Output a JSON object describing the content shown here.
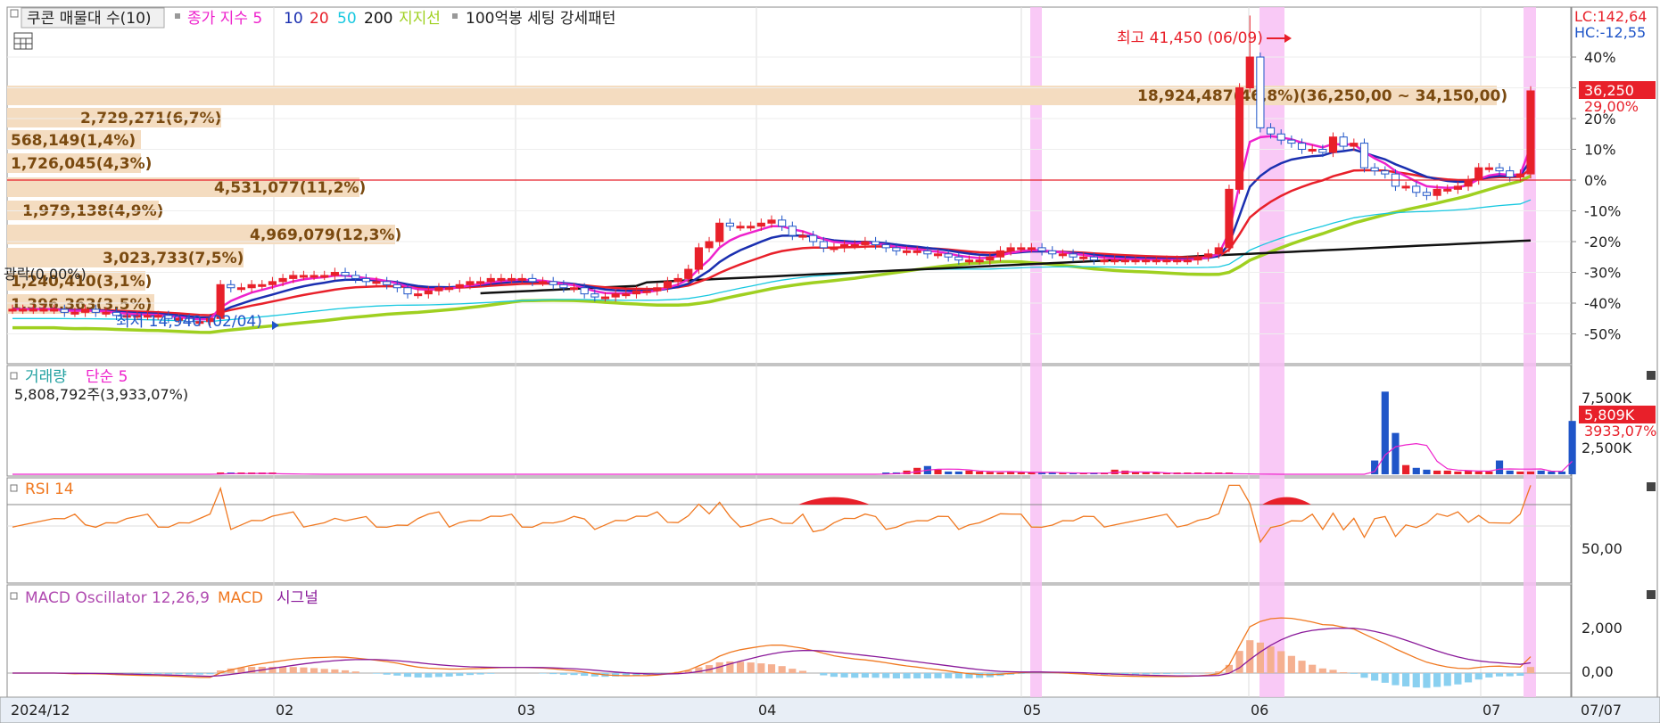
{
  "header": {
    "title_button": "쿠콘 매물대 수(10)",
    "ma_label": "종가 지수 5",
    "ma_periods": [
      {
        "label": "10",
        "color": "#1a2fb0"
      },
      {
        "label": "20",
        "color": "#e8202a"
      },
      {
        "label": "50",
        "color": "#18c8e0"
      },
      {
        "label": "200",
        "color": "#111111"
      },
      {
        "label": "지지선",
        "color": "#9fd020"
      }
    ],
    "extra_label": "100억봉 세팅 강세패턴"
  },
  "colors": {
    "up": "#e8202a",
    "down": "#1f55c8",
    "ma5": "#ee22cc",
    "ma10": "#1a2fb0",
    "ma20": "#e8202a",
    "ma50": "#18c8e0",
    "ma200": "#111111",
    "support": "#9fd020",
    "rsi": "#f07820",
    "signal": "#8a1a9a",
    "osc_pos": "#f5b090",
    "osc_neg": "#8ad0f0",
    "highlight": "#f8c0f4",
    "profile": "#f4dcc0",
    "profile_text": "#7a4a10"
  },
  "price_panel": {
    "lc": "LC:142,64",
    "hc": "HC:-12,55",
    "y_ticks": [
      "40%",
      "30%",
      "20%",
      "10%",
      "0%",
      "-10%",
      "-20%",
      "-30%",
      "-40%",
      "-50%"
    ],
    "current_price": "36,250",
    "current_pct": "29,00%",
    "high_label": "최고 41,450 (06/09)",
    "low_label": "최저 14,940 (02/04)",
    "decline_label": "광락(0,00%)",
    "volume_profile": [
      {
        "text": "18,924,487(46,8%)(36,250,00 ~ 34,150,00)"
      },
      {
        "text": "2,729,271(6,7%)"
      },
      {
        "text": "568,149(1,4%)"
      },
      {
        "text": "1,726,045(4,3%)"
      },
      {
        "text": "4,531,077(11,2%)"
      },
      {
        "text": "1,979,138(4,9%)"
      },
      {
        "text": "4,969,079(12,3%)"
      },
      {
        "text": "3,023,733(7,5%)"
      },
      {
        "text": "1,240,410(3,1%)"
      },
      {
        "text": "1,396,363(3,5%)"
      }
    ]
  },
  "volume_panel": {
    "title": "거래량",
    "ma_label": "단순 5",
    "summary": "5,808,792주(3,933,07%)",
    "y_ticks": [
      "7,500K",
      "2,500K"
    ],
    "current": "5,809K",
    "current_pct": "3933,07%"
  },
  "rsi_panel": {
    "title": "RSI 14",
    "y_tick": "50,00"
  },
  "macd_panel": {
    "title": "MACD Oscillator 12,26,9",
    "macd_label": "MACD",
    "signal_label": "시그널",
    "y_ticks": [
      "2,000",
      "0,00"
    ]
  },
  "x_axis": {
    "labels": [
      "2024/12",
      "02",
      "03",
      "04",
      "05",
      "06",
      "07"
    ],
    "end_label": "07/07"
  },
  "chart_data": {
    "type": "candlestick",
    "x_labels": [
      "2024/12",
      "02",
      "03",
      "04",
      "05",
      "06",
      "07"
    ],
    "y_unit": "percent",
    "price_high": {
      "value": 41450,
      "date": "06/09"
    },
    "price_low": {
      "value": 14940,
      "date": "02/04"
    },
    "last_price": 36250,
    "last_change_pct": 29.0,
    "close_pct": [
      -42,
      -42,
      -42,
      -42,
      -42,
      -43,
      -43,
      -42,
      -43,
      -43,
      -44,
      -44,
      -44,
      -44,
      -44,
      -45,
      -45,
      -46,
      -46,
      -45,
      -34,
      -35,
      -35,
      -34,
      -34,
      -33,
      -32,
      -31,
      -31,
      -31,
      -31,
      -30,
      -31,
      -32,
      -33,
      -33,
      -34,
      -35,
      -37,
      -37,
      -36,
      -35,
      -35,
      -34,
      -33,
      -33,
      -32,
      -32,
      -32,
      -32,
      -33,
      -33,
      -34,
      -35,
      -35,
      -37,
      -38,
      -38,
      -37,
      -37,
      -36,
      -36,
      -35,
      -33,
      -32,
      -29,
      -22,
      -20,
      -14,
      -15,
      -15,
      -15,
      -14,
      -13,
      -15,
      -18,
      -18,
      -20,
      -22,
      -22,
      -21,
      -21,
      -20,
      -21,
      -22,
      -23,
      -23,
      -23,
      -24,
      -24,
      -25,
      -26,
      -26,
      -26,
      -25,
      -23,
      -22,
      -22,
      -22,
      -23,
      -24,
      -24,
      -25,
      -25,
      -26,
      -26,
      -26,
      -26,
      -26,
      -26,
      -26,
      -26,
      -26,
      -26,
      -25,
      -24,
      -22,
      -3,
      30,
      40,
      17,
      15,
      13,
      12,
      10,
      10,
      9,
      14,
      11,
      12,
      4,
      3,
      2,
      -2,
      -2,
      -4,
      -5,
      -3,
      -3,
      -2,
      0,
      4,
      4,
      3,
      1,
      2,
      29
    ],
    "volume_k": [
      0,
      0,
      0,
      0,
      0,
      0,
      0,
      0,
      0,
      0,
      0,
      0,
      0,
      0,
      0,
      0,
      0,
      0,
      0,
      0,
      120,
      150,
      80,
      60,
      60,
      60,
      0,
      0,
      0,
      0,
      0,
      0,
      0,
      0,
      0,
      0,
      0,
      0,
      0,
      0,
      0,
      0,
      0,
      0,
      0,
      0,
      0,
      0,
      0,
      0,
      0,
      0,
      0,
      0,
      0,
      0,
      0,
      0,
      0,
      0,
      0,
      0,
      0,
      0,
      0,
      0,
      0,
      0,
      0,
      0,
      0,
      0,
      0,
      0,
      0,
      0,
      0,
      0,
      0,
      0,
      0,
      0,
      0,
      0,
      100,
      200,
      400,
      700,
      900,
      500,
      300,
      300,
      400,
      300,
      250,
      200,
      300,
      200,
      150,
      150,
      200,
      150,
      100,
      100,
      100,
      150,
      500,
      400,
      100,
      80,
      80,
      60,
      60,
      50,
      50,
      50,
      60,
      60,
      0,
      0,
      0,
      0,
      0,
      0,
      0,
      0,
      0,
      0,
      0,
      0,
      0,
      1500,
      9000,
      4500,
      1000,
      700,
      500,
      400,
      400,
      300,
      400,
      300,
      300,
      1500,
      400,
      300,
      300,
      400,
      300,
      300,
      5809
    ],
    "rsi_last": 80,
    "macd_last": 1250
  }
}
